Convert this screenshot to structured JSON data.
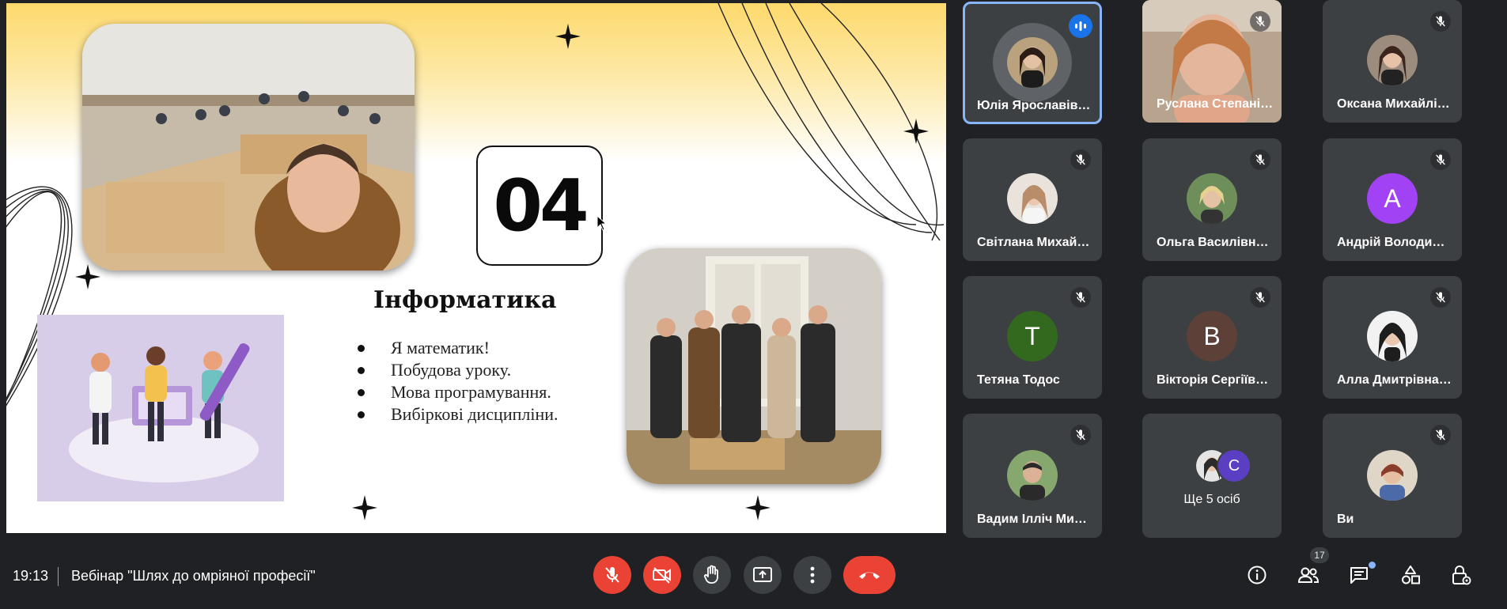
{
  "slide": {
    "number": "04",
    "title": "Інформатика",
    "bullets": [
      "Я математик!",
      "Побудова уроку.",
      "Мова програмування.",
      "Вибіркові дисципліни."
    ]
  },
  "participants": [
    {
      "name": "Юлія Ярославівна ...",
      "state": "speaking",
      "avatar": "photo"
    },
    {
      "name": "Руслана Степанівн...",
      "state": "muted",
      "avatar": "video"
    },
    {
      "name": "Оксана Михайлівна...",
      "state": "muted",
      "avatar": "photo"
    },
    {
      "name": "Світлана Михайлів...",
      "state": "muted",
      "avatar": "photo"
    },
    {
      "name": "Ольга Василівна М...",
      "state": "muted",
      "avatar": "photo"
    },
    {
      "name": "Андрій Володимир...",
      "state": "muted",
      "initial": "A",
      "color": "#a142f4"
    },
    {
      "name": "Тетяна Тодос",
      "state": "muted",
      "initial": "T",
      "color": "#33691e"
    },
    {
      "name": "Вікторія Сергіївна ...",
      "state": "muted",
      "initial": "B",
      "color": "#5d4037"
    },
    {
      "name": "Алла Дмитрівна Па...",
      "state": "muted",
      "avatar": "photo"
    },
    {
      "name": "Вадим Ілліч Мирон...",
      "state": "muted",
      "avatar": "photo"
    },
    {
      "name": "Ви",
      "state": "muted",
      "avatar": "photo"
    }
  ],
  "more_tile": {
    "label": "Ще 5 осіб",
    "initial": "C",
    "color": "#5b3fc2"
  },
  "footer": {
    "time": "19:13",
    "meeting_title": "Вебінар \"Шлях до омріяної професії\"",
    "people_count": "17"
  },
  "colors": {
    "accent": "#8ab4f8",
    "danger": "#ea4335",
    "background": "#202124",
    "tile": "#3c4043"
  },
  "controls": [
    "mic-off-icon",
    "camera-off-icon",
    "raise-hand-icon",
    "present-icon",
    "more-options-icon",
    "end-call-icon"
  ],
  "side_icons": [
    "info-icon",
    "people-icon",
    "chat-icon",
    "activities-icon",
    "host-controls-icon"
  ]
}
